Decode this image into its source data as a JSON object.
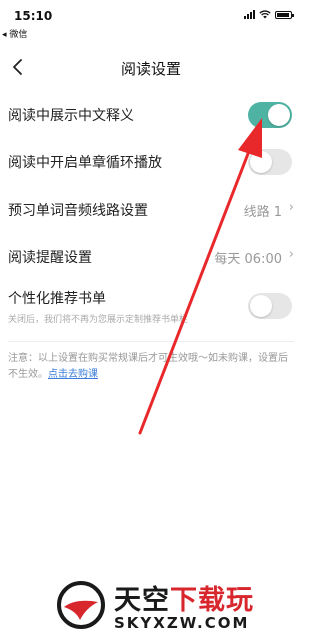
{
  "status_bar": {
    "time": "15:10",
    "back_app": "◂ 微信"
  },
  "nav": {
    "title": "阅读设置"
  },
  "settings": [
    {
      "label": "阅读中展示中文释义",
      "control": "toggle",
      "on": true
    },
    {
      "label": "阅读中开启单章循环播放",
      "control": "toggle",
      "on": false
    },
    {
      "label": "预习单词音频线路设置",
      "control": "link",
      "value": "线路 1"
    },
    {
      "label": "阅读提醒设置",
      "control": "link",
      "value": "每天 06:00"
    },
    {
      "label": "个性化推荐书单",
      "description": "关闭后，我们将不再为您展示定制推荐书单栏",
      "control": "toggle",
      "on": false
    }
  ],
  "notice": {
    "text": "注意：以上设置在购买常规课后才可生效哦～如未购课，设置后不生效。",
    "link": "点击去购课"
  },
  "watermark": {
    "brand_black": "天空",
    "brand_red": "下载玩",
    "url": "SKYXZW.COM"
  },
  "colors": {
    "toggle_on": "#4fb3a3",
    "toggle_off": "#e6e6e6",
    "link": "#3b7dd8",
    "annotation_arrow": "#e8282b"
  }
}
